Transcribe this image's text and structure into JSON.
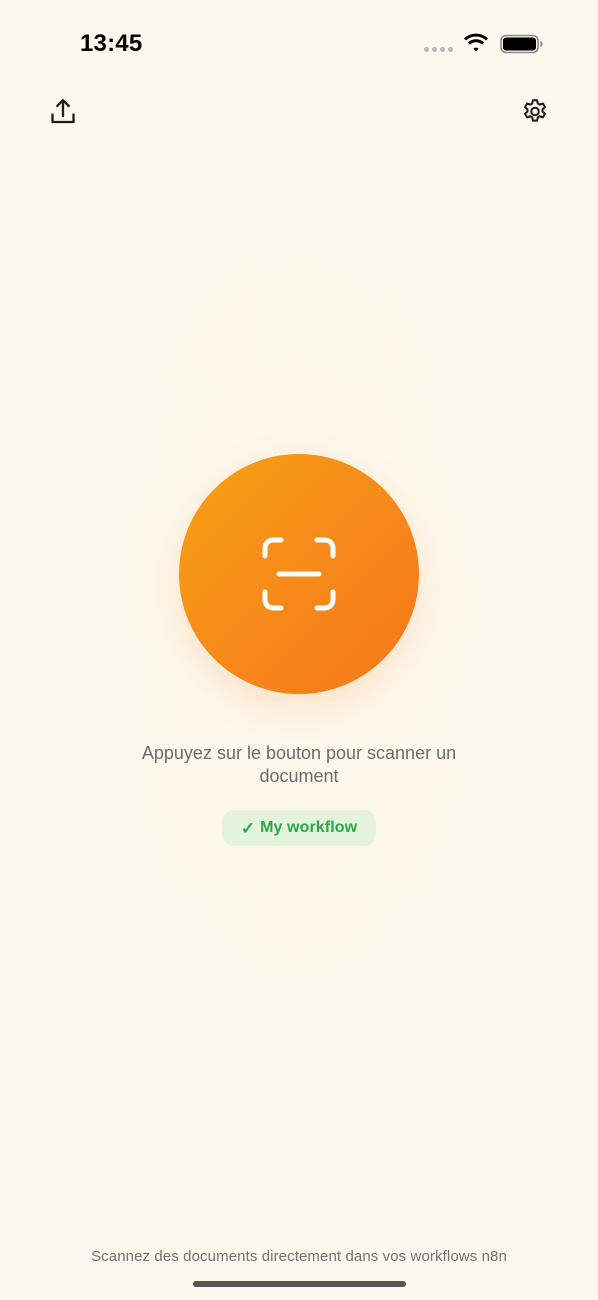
{
  "status_bar": {
    "time": "13:45"
  },
  "toolbar": {
    "upload_icon": "share-upload-icon",
    "settings_icon": "gear-icon"
  },
  "scan": {
    "icon": "document-scanner-icon",
    "instruction": "Appuyez sur le bouton pour scanner un document"
  },
  "workflow": {
    "check_symbol": "✓",
    "name": "My workflow"
  },
  "footer": {
    "tagline": "Scannez des documents directement dans vos workflows n8n"
  },
  "colors": {
    "background": "#fdf8ee",
    "scan_button_start": "#f7a213",
    "scan_button_end": "#f5761c",
    "workflow_badge_bg": "#e4f3dc",
    "workflow_text": "#2aa847"
  }
}
